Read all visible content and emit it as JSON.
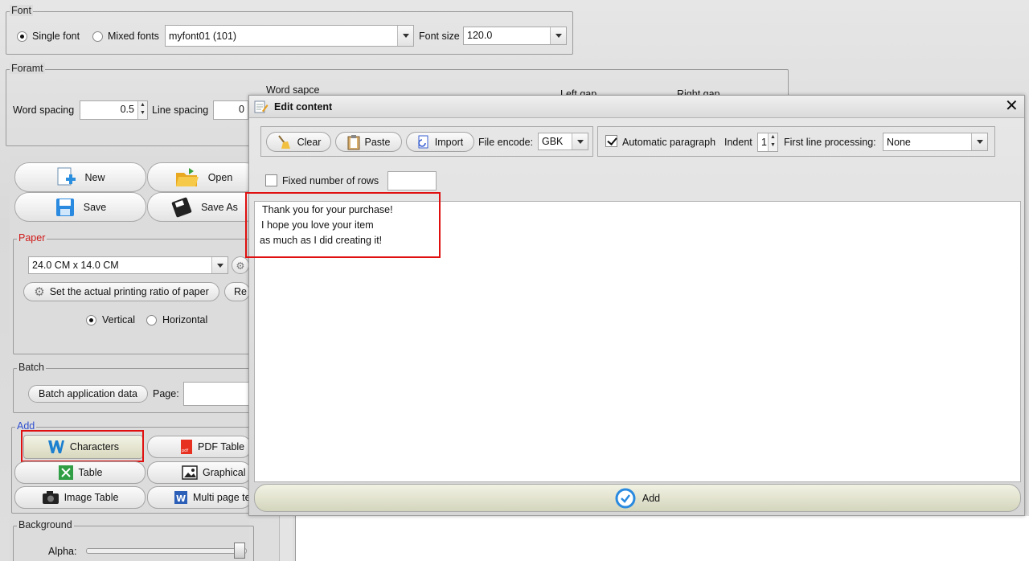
{
  "font_group": {
    "title": "Font",
    "single_font": "Single font",
    "mixed_fonts": "Mixed fonts",
    "font_name": "myfont01 (101)",
    "font_size_label": "Font size",
    "font_size_value": "120.0"
  },
  "format_group": {
    "title": "Foramt",
    "word_spacing_label": "Word spacing",
    "word_spacing_value": "0.5",
    "line_spacing_label": "Line spacing",
    "line_spacing_value": "0",
    "word_space_title": "Word sapce",
    "left_gap": "Left gap",
    "right_gap": "Right gap"
  },
  "file_buttons": {
    "new": "New",
    "open": "Open",
    "save": "Save",
    "save_as": "Save As"
  },
  "paper": {
    "title": "Paper",
    "size": "24.0 CM x 14.0 CM",
    "set_ratio": "Set the actual printing ratio of paper",
    "reset_partial": "Re",
    "vertical": "Vertical",
    "horizontal": "Horizontal"
  },
  "batch": {
    "title": "Batch",
    "apply": "Batch application data",
    "page_label": "Page:"
  },
  "add": {
    "title": "Add",
    "characters": "Characters",
    "pdf_table": "PDF Table",
    "table": "Table",
    "graphical": "Graphical",
    "image_table": "Image Table",
    "multi_page": "Multi page te"
  },
  "background": {
    "title": "Background",
    "alpha_label": "Alpha:"
  },
  "dialog": {
    "title": "Edit content",
    "clear": "Clear",
    "paste": "Paste",
    "import": "Import",
    "file_encode_label": "File encode:",
    "file_encode_value": "GBK",
    "auto_paragraph": "Automatic paragraph",
    "indent_label": "Indent",
    "indent_value": "1",
    "first_line_label": "First line processing:",
    "first_line_value": "None",
    "fixed_rows": "Fixed number of rows",
    "content_lines": [
      "Thank you for your purchase!",
      "I hope you love your item",
      "as much as I did creating it!"
    ],
    "add_button": "Add"
  }
}
